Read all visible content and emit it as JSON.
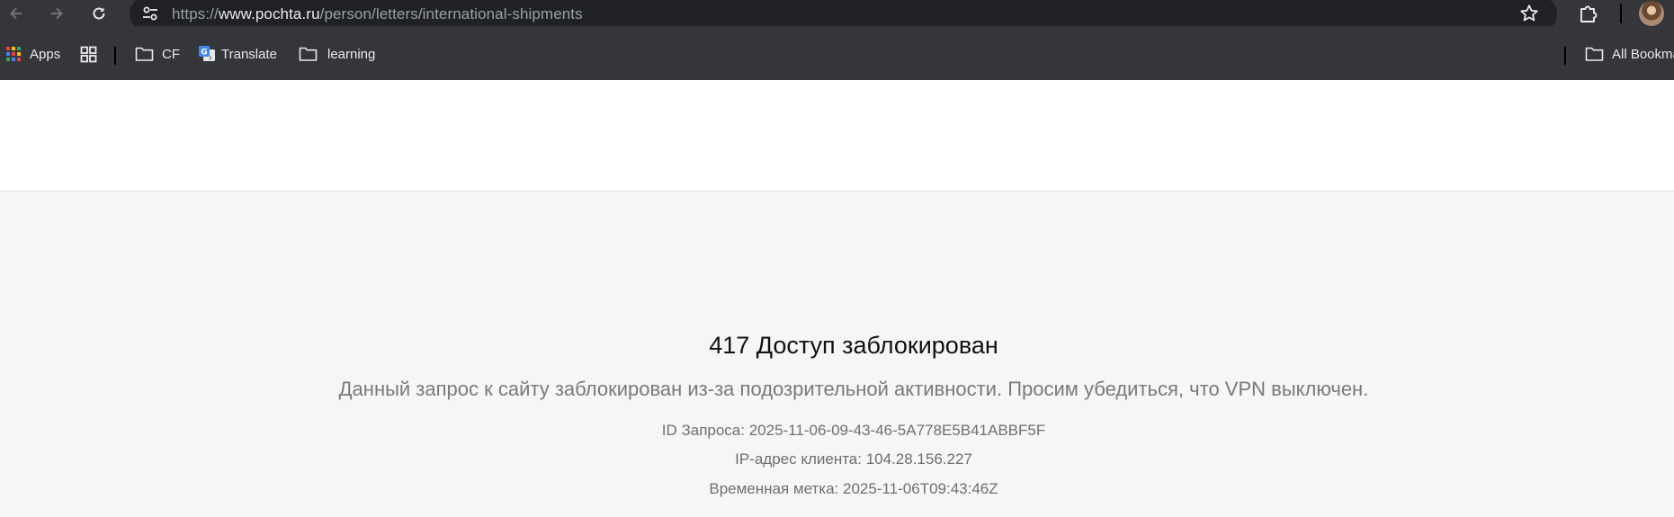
{
  "browser": {
    "url_scheme": "https://",
    "url_host": "www.pochta.ru",
    "url_path": "/person/letters/international-shipments"
  },
  "bookmarks": {
    "apps_label": "Apps",
    "items": [
      {
        "label": "CF",
        "icon": "folder-icon"
      },
      {
        "label": "Translate",
        "icon": "google-translate-icon"
      },
      {
        "label": "learning",
        "icon": "folder-icon"
      }
    ],
    "all_bookmarks_label": "All Bookmarks"
  },
  "error_page": {
    "title": "417 Доступ заблокирован",
    "message": "Данный запрос к сайту заблокирован из-за подозрительной активности. Просим убедиться, что VPN выключен.",
    "request_id": "ID Запроса: 2025-11-06-09-43-46-5A778E5B41ABBF5F",
    "client_ip": "IP-адрес клиента: 104.28.156.227",
    "timestamp": "Временная метка: 2025-11-06T09:43:46Z"
  },
  "colors": {
    "chrome_bg": "#35363a",
    "omnibox_bg": "#202124",
    "page_bg": "#f6f6f6",
    "header_bg": "#ffffff"
  }
}
